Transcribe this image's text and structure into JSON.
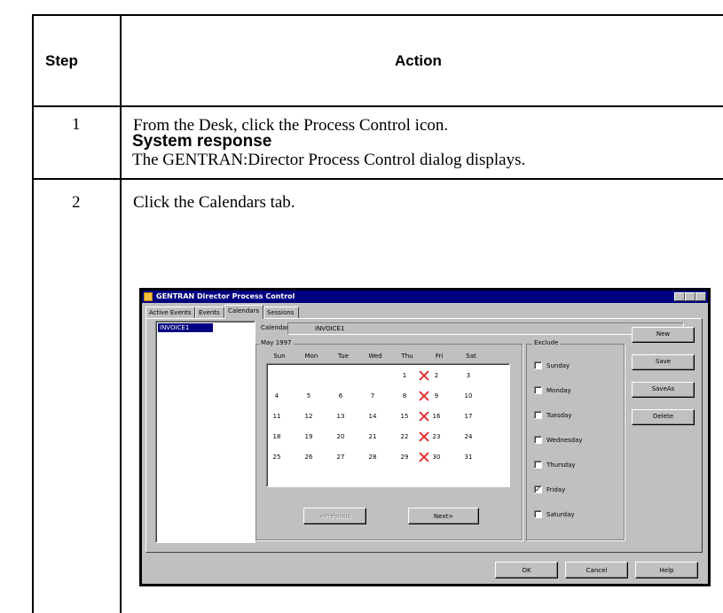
{
  "table": {
    "header": {
      "step": "Step",
      "action": "Action"
    },
    "rows": [
      {
        "step": "1",
        "action": "From the Desk, click the Process Control icon.",
        "response_title": "System response",
        "response_text": "The GENTRAN:Director Process Control dialog displays."
      },
      {
        "step": "2",
        "action": "Click the Calendars tab."
      }
    ]
  },
  "dialog": {
    "title": "GENTRAN Director Process Control",
    "tabs": [
      "Active Events",
      "Events",
      "Calendars",
      "Sessions"
    ],
    "active_tab": "Calendars",
    "calendar_list": [
      "INVOICE1"
    ],
    "calendar_label": "Calendar",
    "calendar_value": "INVOICE1",
    "month_label": "May 1997",
    "day_headers": [
      "Sun",
      "Mon",
      "Tue",
      "Wed",
      "Thu",
      "Fri",
      "Sat"
    ],
    "weeks": [
      [
        "",
        "",
        "",
        "",
        "1",
        "2",
        "3"
      ],
      [
        "4",
        "5",
        "6",
        "7",
        "8",
        "9",
        "10"
      ],
      [
        "11",
        "12",
        "13",
        "14",
        "15",
        "16",
        "17"
      ],
      [
        "18",
        "19",
        "20",
        "21",
        "22",
        "23",
        "24"
      ],
      [
        "25",
        "26",
        "27",
        "28",
        "29",
        "30",
        "31"
      ]
    ],
    "excluded_column": "Fri",
    "nav_buttons": {
      "previous": "<Previous",
      "next": "Next>"
    },
    "exclude_label": "Exclude",
    "exclude_days": [
      {
        "label": "Sunday",
        "checked": false
      },
      {
        "label": "Monday",
        "checked": false
      },
      {
        "label": "Tuesday",
        "checked": false
      },
      {
        "label": "Wednesday",
        "checked": false
      },
      {
        "label": "Thursday",
        "checked": false
      },
      {
        "label": "Friday",
        "checked": true
      },
      {
        "label": "Saturday",
        "checked": false
      }
    ],
    "side_buttons": [
      "New",
      "Save",
      "SaveAs",
      "Delete"
    ],
    "footer_buttons": [
      "OK",
      "Cancel",
      "Help"
    ]
  }
}
